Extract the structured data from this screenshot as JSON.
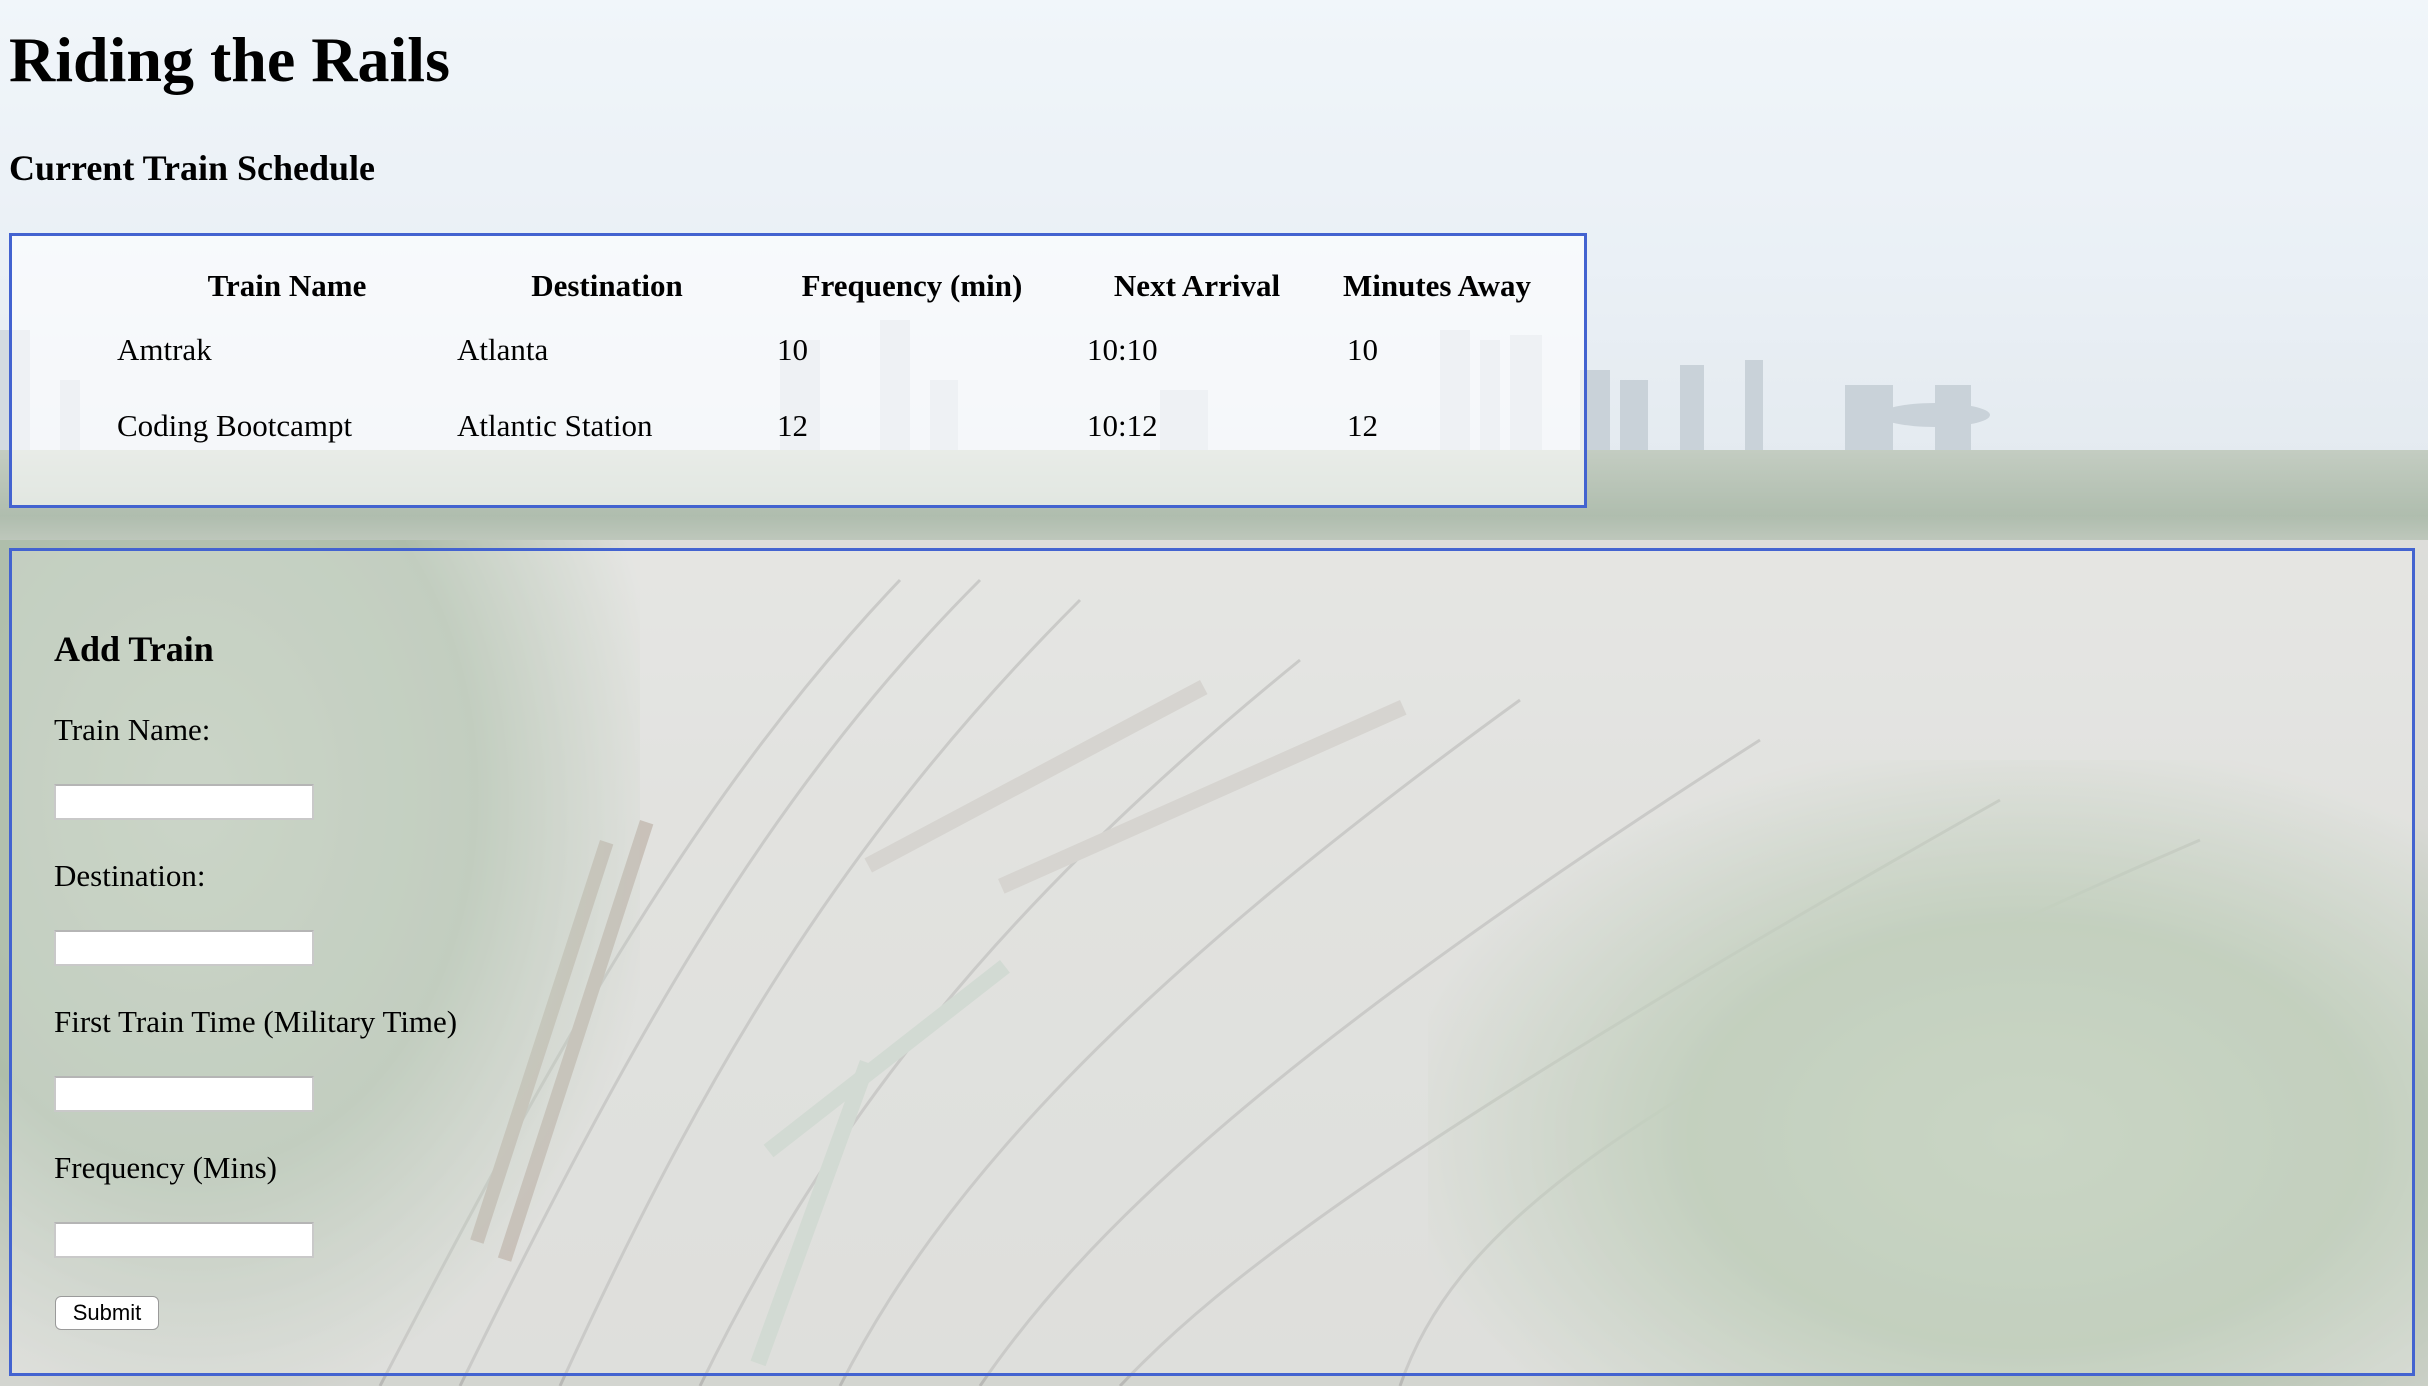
{
  "page": {
    "title": "Riding the Rails",
    "schedule_heading": "Current Train Schedule"
  },
  "schedule": {
    "columns": [
      "Train Name",
      "Destination",
      "Frequency (min)",
      "Next Arrival",
      "Minutes Away"
    ],
    "rows": [
      [
        "Amtrak",
        "Atlanta",
        "10",
        "10:10",
        "10"
      ],
      [
        "Coding Bootcampt",
        "Atlantic Station",
        "12",
        "10:12",
        "12"
      ]
    ]
  },
  "add_train": {
    "heading": "Add Train",
    "fields": [
      {
        "label": "Train Name:",
        "value": ""
      },
      {
        "label": "Destination:",
        "value": ""
      },
      {
        "label": "First Train Time (Military Time)",
        "value": ""
      },
      {
        "label": "Frequency (Mins)",
        "value": ""
      }
    ],
    "submit_label": "Submit"
  },
  "colors": {
    "panel_border": "#4363d0"
  }
}
